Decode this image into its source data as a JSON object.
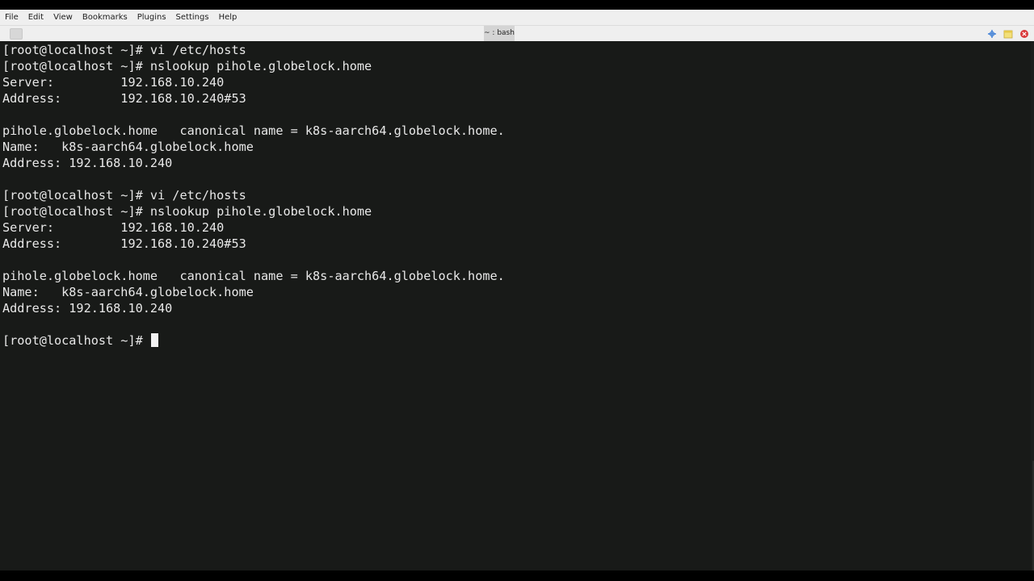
{
  "menubar": {
    "items": [
      "File",
      "Edit",
      "View",
      "Bookmarks",
      "Plugins",
      "Settings",
      "Help"
    ]
  },
  "tabs": [
    {
      "label": "~ : bash",
      "active": true
    }
  ],
  "terminal": {
    "background": "#181a18",
    "foreground": "#e8e8e8",
    "lines": [
      "[root@localhost ~]# vi /etc/hosts",
      "[root@localhost ~]# nslookup pihole.globelock.home",
      "Server:         192.168.10.240",
      "Address:        192.168.10.240#53",
      "",
      "pihole.globelock.home   canonical name = k8s-aarch64.globelock.home.",
      "Name:   k8s-aarch64.globelock.home",
      "Address: 192.168.10.240",
      "",
      "[root@localhost ~]# vi /etc/hosts",
      "[root@localhost ~]# nslookup pihole.globelock.home",
      "Server:         192.168.10.240",
      "Address:        192.168.10.240#53",
      "",
      "pihole.globelock.home   canonical name = k8s-aarch64.globelock.home.",
      "Name:   k8s-aarch64.globelock.home",
      "Address: 192.168.10.240",
      "",
      "[root@localhost ~]# "
    ]
  },
  "icons": {
    "tab_left": "new-tab-icon",
    "tab_right": [
      "quick-commands-icon",
      "notes-icon",
      "close-tab-icon"
    ]
  }
}
